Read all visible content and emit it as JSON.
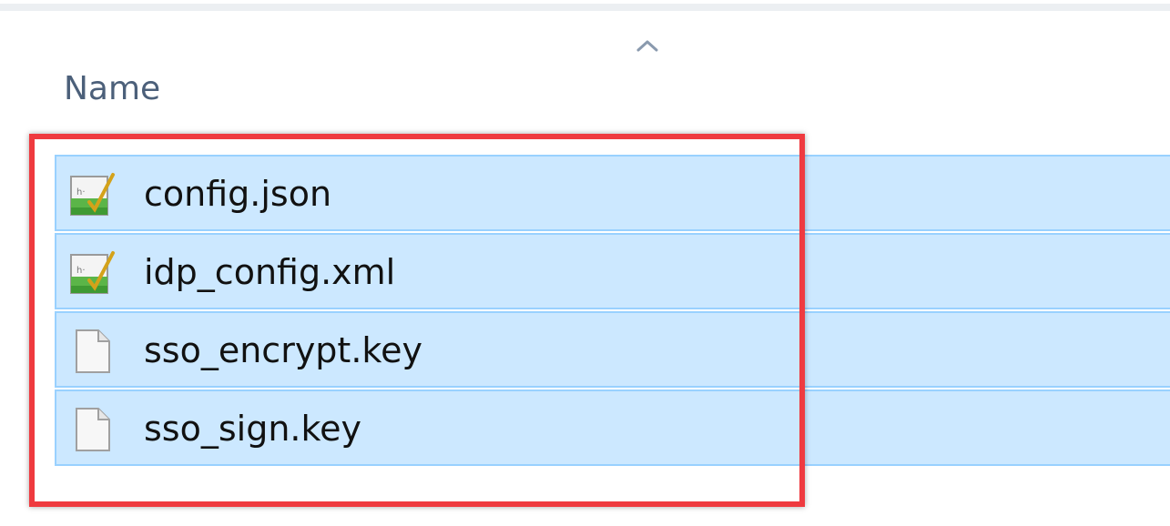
{
  "header": {
    "name_label": "Name",
    "sort_icon": "chevron-up-icon"
  },
  "files": [
    {
      "name": "config.json",
      "icon": "notepad-document-icon"
    },
    {
      "name": "idp_config.xml",
      "icon": "notepad-document-icon"
    },
    {
      "name": "sso_encrypt.key",
      "icon": "blank-file-icon"
    },
    {
      "name": "sso_sign.key",
      "icon": "blank-file-icon"
    }
  ],
  "colors": {
    "selection_fill": "#cce8ff",
    "selection_border": "#99d1ff",
    "highlight_box": "#ef3a3f",
    "header_text": "#4c607a"
  }
}
